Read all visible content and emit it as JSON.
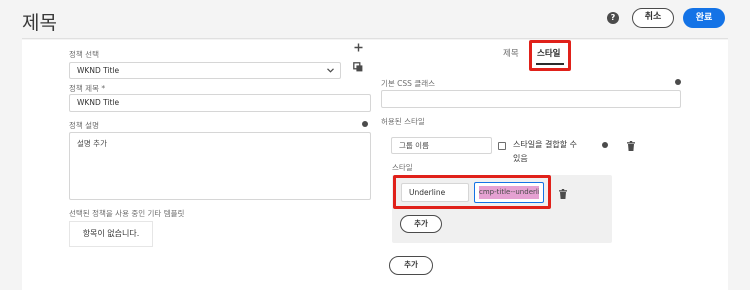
{
  "header": {
    "title": "제목",
    "cancel_label": "취소",
    "done_label": "완료",
    "help_icon": "?"
  },
  "policy": {
    "select_label": "정책 선택",
    "select_value": "WKND Title",
    "title_label": "정책 제목 *",
    "title_value": "WKND Title",
    "desc_label": "정책 설명",
    "desc_placeholder": "설명 추가",
    "other_templates_label": "선택된 정책을 사용 중인 기타 템플릿",
    "no_items": "항목이 없습니다."
  },
  "tabs": [
    {
      "label": "제목",
      "active": false
    },
    {
      "label": "스타일",
      "active": true
    }
  ],
  "styles": {
    "css_class_label": "기본 CSS 클래스",
    "css_class_value": "",
    "allowed_styles_label": "허용된 스타일",
    "group_name_placeholder": "그룹 이름",
    "combine_label_line1": "스타일을 결합할 수",
    "combine_label_line2": "있음",
    "style_label": "스타일",
    "style_name_value": "Underline",
    "style_class_value": "cmp-title--underline",
    "add_style_button": "추가",
    "add_group_button": "추가"
  },
  "icons": {
    "add": "add-icon",
    "copy": "copy-icon",
    "trash": "trash-icon",
    "info": "info-icon",
    "chevron": "chevron-down-icon"
  },
  "colors": {
    "accent": "#1473e6",
    "highlight": "#e0211a",
    "selection": "#e5a1d2"
  }
}
